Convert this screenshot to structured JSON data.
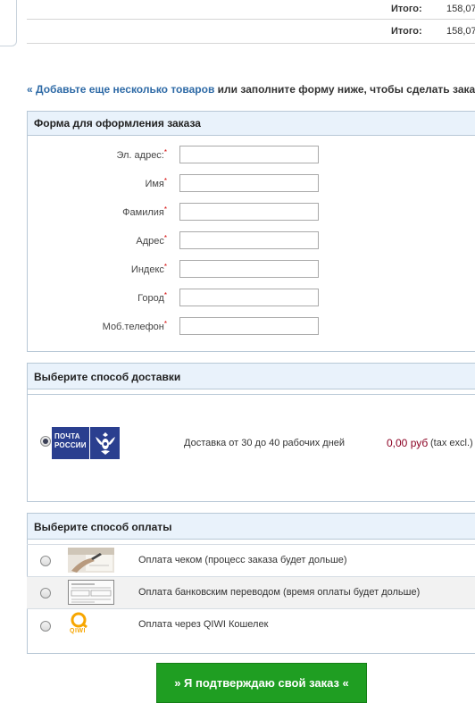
{
  "totals": [
    {
      "label": "Итого:",
      "value": "158,07"
    },
    {
      "label": "Итого:",
      "value": "158,07"
    }
  ],
  "cta": {
    "link_text": "« Добавьте еще несколько товаров",
    "rest_text": "или заполните форму ниже, чтобы сделать заказ"
  },
  "order_form": {
    "title": "Форма для оформления заказа",
    "required_mark": "*",
    "fields": [
      {
        "label": "Эл. адрес:",
        "value": ""
      },
      {
        "label": "Имя",
        "value": ""
      },
      {
        "label": "Фамилия",
        "value": ""
      },
      {
        "label": "Адрес",
        "value": ""
      },
      {
        "label": "Индекс",
        "value": ""
      },
      {
        "label": "Город",
        "value": ""
      },
      {
        "label": "Моб.телефон",
        "value": ""
      }
    ]
  },
  "delivery": {
    "title": "Выберите способ доставки",
    "options": [
      {
        "logo_text": "ПОЧТА РОССИИ",
        "text": "Доставка от 30 до 40 рабочих дней",
        "price": "0,00 руб",
        "tax": "(tax excl.)",
        "selected": true
      }
    ],
    "price_color": "#8b0022"
  },
  "payment": {
    "title": "Выберите способ оплаты",
    "options": [
      {
        "icon": "check-image-icon",
        "text": "Оплата чеком (процесс заказа будет дольше)",
        "selected": false
      },
      {
        "icon": "bank-document-icon",
        "text": "Оплата банковским переводом (время оплаты будет дольше)",
        "selected": false
      },
      {
        "icon": "qiwi-logo-icon",
        "logo_text": "QIWI",
        "text": "Оплата через QIWI Кошелек",
        "selected": false
      }
    ]
  },
  "confirm_button": {
    "label": "»  Я подтверждаю свой заказ  «"
  },
  "colors": {
    "accent_blue": "#2e6aa6",
    "panel_header": "#e9f2fb",
    "button_green": "#1f9e22"
  }
}
